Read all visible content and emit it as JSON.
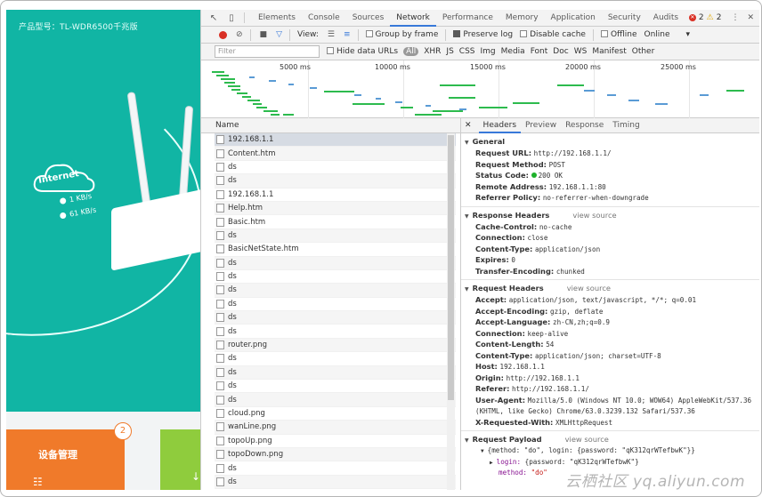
{
  "router_page": {
    "model_label": "产品型号：TL-WDR6500千兆版",
    "cloud_label": "Internet",
    "upload_speed": "1 KB/s",
    "download_speed": "61 KB/s",
    "device_card_label": "设备管理",
    "device_badge": "2",
    "accent_color": "#11b5a4"
  },
  "devtools": {
    "tabs": [
      "Elements",
      "Console",
      "Sources",
      "Network",
      "Performance",
      "Memory",
      "Application",
      "Security",
      "Audits"
    ],
    "active_tab": "Network",
    "error_count": "2",
    "warning_count": "2",
    "toolbar": {
      "view_label": "View:",
      "group_by_frame": "Group by frame",
      "preserve_log": "Preserve log",
      "disable_cache": "Disable cache",
      "offline": "Offline",
      "online": "Online"
    },
    "filter": {
      "placeholder": "Filter",
      "hide_data_urls": "Hide data URLs",
      "types": [
        "All",
        "XHR",
        "JS",
        "CSS",
        "Img",
        "Media",
        "Font",
        "Doc",
        "WS",
        "Manifest",
        "Other"
      ]
    },
    "timeline_ticks": [
      "5000 ms",
      "10000 ms",
      "15000 ms",
      "20000 ms",
      "25000 ms"
    ],
    "name_header": "Name",
    "requests": [
      "192.168.1.1",
      "Content.htm",
      "ds",
      "ds",
      "192.168.1.1",
      "Help.htm",
      "Basic.htm",
      "ds",
      "BasicNetState.htm",
      "ds",
      "ds",
      "ds",
      "ds",
      "ds",
      "ds",
      "router.png",
      "ds",
      "ds",
      "ds",
      "ds",
      "cloud.png",
      "wanLine.png",
      "topoUp.png",
      "topoDown.png",
      "ds",
      "ds"
    ],
    "detail_tabs": [
      "Headers",
      "Preview",
      "Response",
      "Timing"
    ],
    "active_detail_tab": "Headers",
    "general": {
      "title": "General",
      "items": [
        {
          "k": "Request URL:",
          "v": "http://192.168.1.1/"
        },
        {
          "k": "Request Method:",
          "v": "POST"
        },
        {
          "k": "Status Code:",
          "v": "200 OK"
        },
        {
          "k": "Remote Address:",
          "v": "192.168.1.1:80"
        },
        {
          "k": "Referrer Policy:",
          "v": "no-referrer-when-downgrade"
        }
      ]
    },
    "response_headers": {
      "title": "Response Headers",
      "view_source": "view source",
      "items": [
        {
          "k": "Cache-Control:",
          "v": "no-cache"
        },
        {
          "k": "Connection:",
          "v": "close"
        },
        {
          "k": "Content-Type:",
          "v": "application/json"
        },
        {
          "k": "Expires:",
          "v": "0"
        },
        {
          "k": "Transfer-Encoding:",
          "v": "chunked"
        }
      ]
    },
    "request_headers": {
      "title": "Request Headers",
      "view_source": "view source",
      "items": [
        {
          "k": "Accept:",
          "v": "application/json, text/javascript, */*; q=0.01"
        },
        {
          "k": "Accept-Encoding:",
          "v": "gzip, deflate"
        },
        {
          "k": "Accept-Language:",
          "v": "zh-CN,zh;q=0.9"
        },
        {
          "k": "Connection:",
          "v": "keep-alive"
        },
        {
          "k": "Content-Length:",
          "v": "54"
        },
        {
          "k": "Content-Type:",
          "v": "application/json; charset=UTF-8"
        },
        {
          "k": "Host:",
          "v": "192.168.1.1"
        },
        {
          "k": "Origin:",
          "v": "http://192.168.1.1"
        },
        {
          "k": "Referer:",
          "v": "http://192.168.1.1/"
        },
        {
          "k": "User-Agent:",
          "v": "Mozilla/5.0 (Windows NT 10.0; WOW64) AppleWebKit/537.36"
        },
        {
          "k": "",
          "v": "(KHTML, like Gecko) Chrome/63.0.3239.132 Safari/537.36"
        },
        {
          "k": "X-Requested-With:",
          "v": "XMLHttpRequest"
        }
      ]
    },
    "request_payload": {
      "title": "Request Payload",
      "view_source": "view source",
      "line1": "{method: \"do\", login: {password: \"qK312qrWTefbwK\"}}",
      "line2_key": "login:",
      "line2_val": "{password: \"qK312qrWTefbwK\"}",
      "line3_key": "method:",
      "line3_val": "\"do\""
    }
  },
  "watermark": "云栖社区 yq.aliyun.com"
}
